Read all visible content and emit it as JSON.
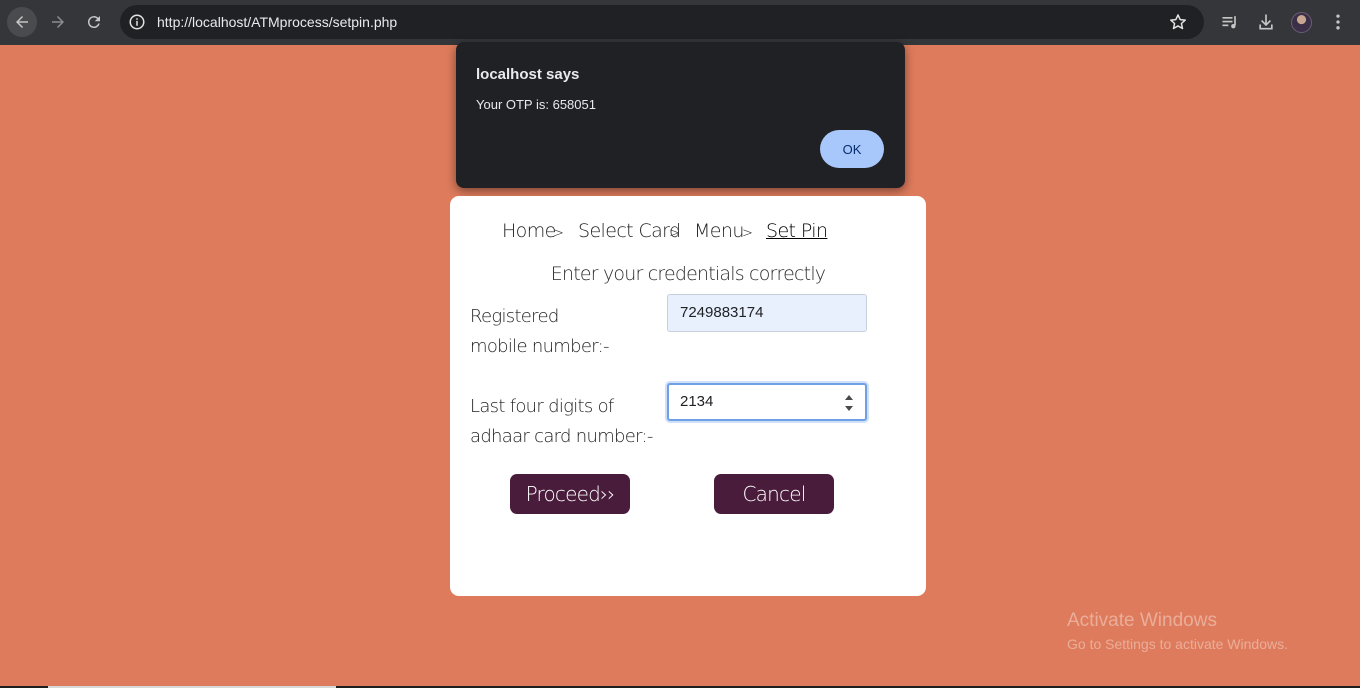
{
  "browser": {
    "url": "http://localhost/ATMprocess/setpin.php",
    "icons": [
      "back-arrow-icon",
      "forward-arrow-icon",
      "reload-icon",
      "site-info-icon",
      "bookmark-star-icon",
      "media-control-icon",
      "download-icon",
      "profile-avatar",
      "more-menu-icon"
    ]
  },
  "dialog": {
    "title": "localhost says",
    "message": "Your OTP is: 658051",
    "ok_label": "OK"
  },
  "breadcrumb": {
    "items": [
      "Home",
      "Select Card",
      "Menu",
      "Set Pin"
    ],
    "separator": ">"
  },
  "form": {
    "subtitle": "Enter your credentials correctly",
    "mobile_label_line1": "Registered",
    "mobile_label_line2": "mobile number:-",
    "mobile_value": "7249883174",
    "aadhaar_label_line1": "Last four digits of",
    "aadhaar_label_line2": "adhaar card number:-",
    "aadhaar_value": "2134",
    "proceed_label": "Proceed››",
    "cancel_label": "Cancel"
  },
  "watermark": {
    "line1": "Activate Windows",
    "line2": "Go to Settings to activate Windows."
  },
  "colors": {
    "page_background": "#de7b5c",
    "button": "#4a1c3c",
    "dialog_background": "#202124",
    "ok_button": "#a8c7fa"
  }
}
